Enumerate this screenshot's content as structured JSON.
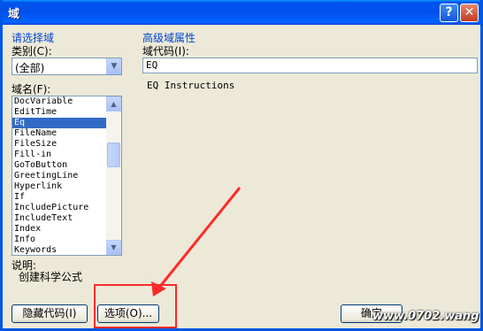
{
  "window": {
    "title": "域",
    "help_icon": "?",
    "close_icon": "✕"
  },
  "left": {
    "group_title": "请选择域",
    "category_label": "类别(C):",
    "category_value": "(全部)",
    "fieldname_label": "域名(F):",
    "fields": [
      "DocVariable",
      "EditTime",
      "Eq",
      "FileName",
      "FileSize",
      "Fill-in",
      "GoToButton",
      "GreetingLine",
      "Hyperlink",
      "If",
      "IncludePicture",
      "IncludeText",
      "Index",
      "Info",
      "Keywords"
    ],
    "selected_index": 2,
    "description_label": "说明:",
    "description_text": "创建科学公式"
  },
  "right": {
    "group_title": "高级域属性",
    "code_label": "域代码(I):",
    "code_value": "EQ",
    "instructions": "EQ Instructions"
  },
  "buttons": {
    "hide_codes": "隐藏代码(I)",
    "options": "选项(O)...",
    "ok": "确定"
  },
  "watermark": "www.0702.wang",
  "annotation_color": "#ff2a2a"
}
